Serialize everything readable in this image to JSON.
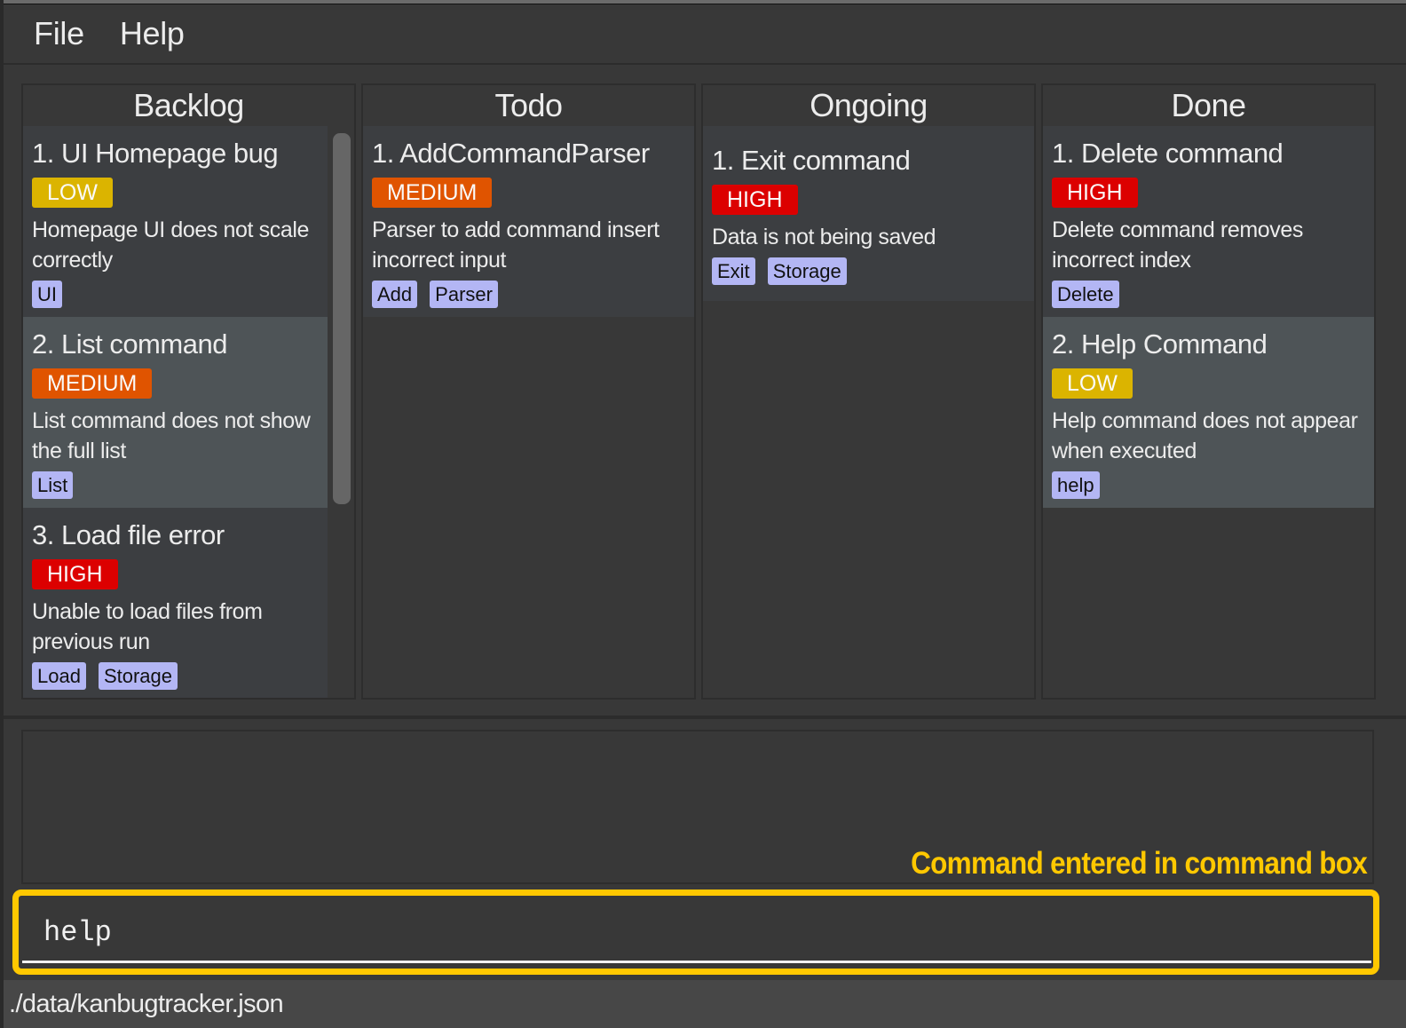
{
  "menu": {
    "items": [
      {
        "label": "File"
      },
      {
        "label": "Help"
      }
    ]
  },
  "colors": {
    "low": "#dbb400",
    "medium": "#e05400",
    "high": "#dc0000",
    "tag": "#b3b6f4",
    "annotation": "#ffc800"
  },
  "columns": [
    {
      "title": "Backlog",
      "cards": [
        {
          "title": "1. UI Homepage bug",
          "priority": "LOW",
          "description": "Homepage UI does not scale correctly",
          "tags": [
            "UI"
          ]
        },
        {
          "title": "2. List command",
          "priority": "MEDIUM",
          "description": "List command does not show the full list",
          "tags": [
            "List"
          ]
        },
        {
          "title": "3. Load file error",
          "priority": "HIGH",
          "description": "Unable to load files from previous run",
          "tags": [
            "Load",
            "Storage"
          ]
        }
      ]
    },
    {
      "title": "Todo",
      "cards": [
        {
          "title": "1. AddCommandParser",
          "priority": "MEDIUM",
          "description": "Parser to add command insert incorrect input",
          "tags": [
            "Add",
            "Parser"
          ]
        }
      ]
    },
    {
      "title": "Ongoing",
      "cards": [
        {
          "title": "1. Exit command",
          "priority": "HIGH",
          "description": "Data is not being saved",
          "tags": [
            "Exit",
            "Storage"
          ]
        }
      ]
    },
    {
      "title": "Done",
      "cards": [
        {
          "title": "1. Delete command",
          "priority": "HIGH",
          "description": "Delete command removes incorrect index",
          "tags": [
            "Delete"
          ]
        },
        {
          "title": "2. Help Command",
          "priority": "LOW",
          "description": "Help command does not appear when executed",
          "tags": [
            "help"
          ]
        }
      ]
    }
  ],
  "result_display": {
    "text": ""
  },
  "annotation": {
    "text": "Command entered in command box"
  },
  "command_box": {
    "value": "help",
    "placeholder": ""
  },
  "status_bar": {
    "file_path": "./data/kanbugtracker.json"
  }
}
